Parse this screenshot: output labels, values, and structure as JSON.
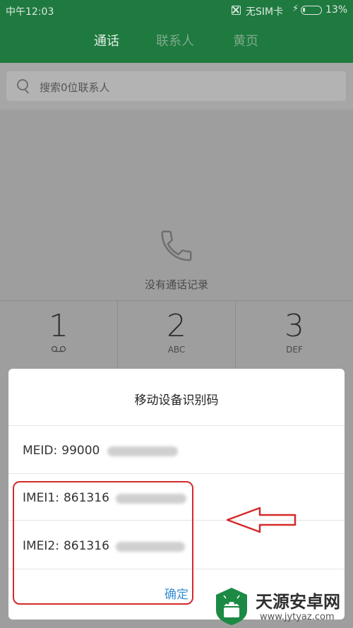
{
  "status_bar": {
    "time": "中午12:03",
    "sim_status": "无SIM卡",
    "battery": "13%",
    "battery_level": 0.13
  },
  "tabs": [
    {
      "label": "通话",
      "active": true
    },
    {
      "label": "联系人",
      "active": false
    },
    {
      "label": "黄页",
      "active": false
    }
  ],
  "search": {
    "placeholder": "搜索0位联系人"
  },
  "call_log": {
    "empty_text": "没有通话记录",
    "icon": "phone-icon"
  },
  "dialpad": {
    "keys": [
      {
        "digit": "1",
        "letters": "",
        "icon": "voicemail-icon"
      },
      {
        "digit": "2",
        "letters": "ABC"
      },
      {
        "digit": "3",
        "letters": "DEF"
      }
    ]
  },
  "dialog": {
    "title": "移动设备识别码",
    "meid": {
      "label": "MEID:",
      "value": "99000"
    },
    "imei1": {
      "label": "IMEI1:",
      "value": "861316"
    },
    "imei2": {
      "label": "IMEI2:",
      "value": "861316"
    },
    "confirm_label": "确定"
  },
  "annotation": {
    "color": "#d42a2a"
  },
  "watermark": {
    "title": "天源安卓网",
    "url": "www.jytyaz.com"
  },
  "colors": {
    "header": "#1f7a40",
    "accent": "#3a8fd0"
  }
}
